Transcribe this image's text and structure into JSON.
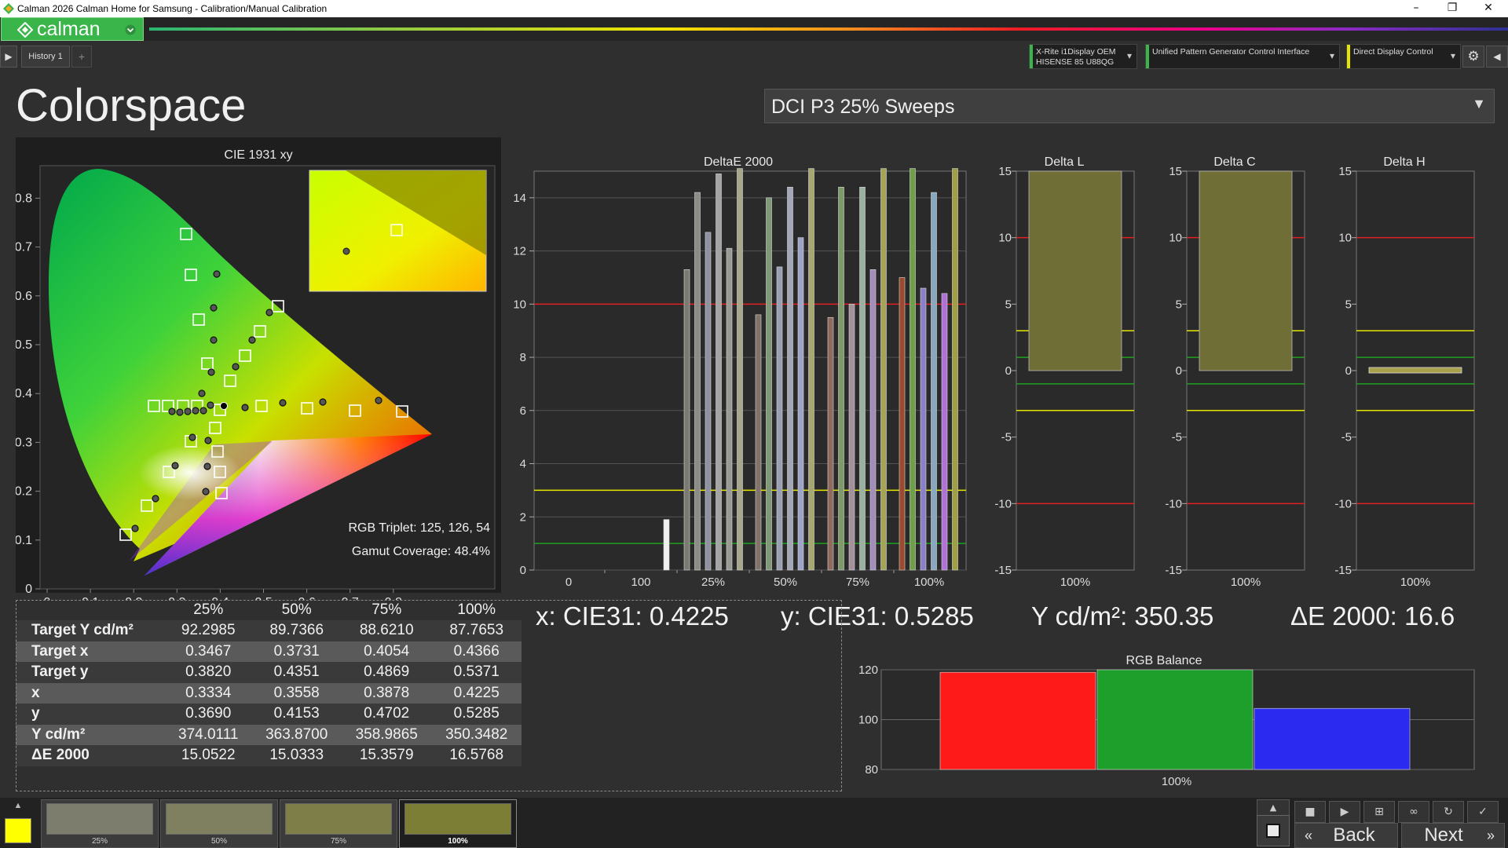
{
  "window": {
    "title": "Calman 2026 Calman Home for Samsung  - Calibration/Manual Calibration",
    "minimize": "–",
    "maximize": "❐",
    "close": "✕"
  },
  "brand": {
    "name": "calman",
    "accent": "#39b54a"
  },
  "toolbar": {
    "history_tab": "History 1",
    "add_tab": "+",
    "devices": [
      {
        "line1": "X-Rite i1Display OEM",
        "line2": "HISENSE 85 U88QG",
        "color": "#39b54a"
      },
      {
        "line1": "Unified Pattern Generator Control Interface",
        "line2": "",
        "color": "#39b54a"
      },
      {
        "line1": "Direct Display Control",
        "line2": "",
        "color": "#e6e600"
      }
    ]
  },
  "page": {
    "title": "Colorspace",
    "workflow_select": "DCI P3 25% Sweeps"
  },
  "cie": {
    "title": "CIE 1931 xy",
    "rgb_triplet": "RGB Triplet: 125, 126, 54",
    "gamut_coverage": "Gamut Coverage: 48.4%",
    "x_ticks": [
      "0",
      "0.1",
      "0.2",
      "0.3",
      "0.4",
      "0.5",
      "0.6",
      "0.7",
      "0.8"
    ],
    "y_ticks": [
      "0",
      "0.1",
      "0.2",
      "0.3",
      "0.4",
      "0.5",
      "0.6",
      "0.7",
      "0.8"
    ]
  },
  "readouts": {
    "x": "x: CIE31: 0.4225",
    "y": "y: CIE31: 0.5285",
    "Y": "Y cd/m²: 350.35",
    "de": "ΔE 2000: 16.6"
  },
  "table": {
    "headers": [
      "",
      "25%",
      "50%",
      "75%",
      "100%"
    ],
    "rows": [
      [
        "Target Y cd/m²",
        "92.2985",
        "89.7366",
        "88.6210",
        "87.7653"
      ],
      [
        "Target x",
        "0.3467",
        "0.3731",
        "0.4054",
        "0.4366"
      ],
      [
        "Target y",
        "0.3820",
        "0.4351",
        "0.4869",
        "0.5371"
      ],
      [
        "x",
        "0.3334",
        "0.3558",
        "0.3878",
        "0.4225"
      ],
      [
        "y",
        "0.3690",
        "0.4153",
        "0.4702",
        "0.5285"
      ],
      [
        "Y cd/m²",
        "374.0111",
        "363.8700",
        "358.9865",
        "350.3482"
      ],
      [
        "ΔE 2000",
        "15.0522",
        "15.0333",
        "15.3579",
        "16.5768"
      ]
    ]
  },
  "patches": [
    {
      "label": "25%",
      "color": "#7d7d6e"
    },
    {
      "label": "50%",
      "color": "#7f8060"
    },
    {
      "label": "75%",
      "color": "#7e7f48"
    },
    {
      "label": "100%",
      "color": "#7d7e36"
    }
  ],
  "nav": {
    "back": "Back",
    "next": "Next"
  },
  "chart_data": [
    {
      "type": "bar",
      "title": "DeltaE 2000",
      "ylim": [
        0,
        15
      ],
      "y_ticks": [
        "0",
        "2",
        "4",
        "6",
        "8",
        "10",
        "12",
        "14"
      ],
      "x_ticks": [
        "0",
        "100",
        "25%",
        "50%",
        "75%",
        "100%"
      ],
      "reference_lines": [
        {
          "value": 10,
          "color": "#e02020"
        },
        {
          "value": 3,
          "color": "#e6e600"
        },
        {
          "value": 1,
          "color": "#20a020"
        }
      ],
      "groups": [
        {
          "label": "100",
          "values": [
            1.9
          ],
          "colors": [
            "#f0f0f0"
          ]
        },
        {
          "label": "25%",
          "values": [
            11.3,
            14.2,
            12.7,
            14.9,
            12.1,
            15.1
          ],
          "colors": [
            "#7a7a72",
            "#8c8c86",
            "#8e92a0",
            "#a4a4a4",
            "#9a9a94",
            "#a7a78c"
          ]
        },
        {
          "label": "50%",
          "values": [
            9.6,
            14.0,
            11.4,
            14.4,
            12.5,
            15.1
          ],
          "colors": [
            "#80746a",
            "#7e9878",
            "#9aa0b4",
            "#a4a8b6",
            "#9ea4c8",
            "#a6a870"
          ]
        },
        {
          "label": "75%",
          "values": [
            9.5,
            14.4,
            10.0,
            14.4,
            11.3,
            15.1
          ],
          "colors": [
            "#906a5e",
            "#7e9a68",
            "#a4909a",
            "#9ab0a0",
            "#a28cbc",
            "#a4a458"
          ]
        },
        {
          "label": "100%",
          "values": [
            11.0,
            15.1,
            10.6,
            14.2,
            10.4,
            15.1
          ],
          "colors": [
            "#9a4a2e",
            "#6ea04a",
            "#8a80c8",
            "#88a8c0",
            "#b070d8",
            "#a0a042"
          ]
        }
      ]
    },
    {
      "type": "bar",
      "title": "Delta L",
      "ylim": [
        -15,
        15
      ],
      "categories": [
        "100%"
      ],
      "values": [
        15.0
      ],
      "reference_lines": [
        10,
        3,
        1,
        -1,
        -3,
        -10
      ],
      "y_ticks": [
        "15",
        "10",
        "5",
        "0",
        "-5",
        "-10",
        "-15"
      ]
    },
    {
      "type": "bar",
      "title": "Delta C",
      "ylim": [
        -15,
        15
      ],
      "categories": [
        "100%"
      ],
      "values": [
        15.0
      ],
      "reference_lines": [
        10,
        3,
        1,
        -1,
        -3,
        -10
      ],
      "y_ticks": [
        "15",
        "10",
        "5",
        "0",
        "-5",
        "-10",
        "-15"
      ]
    },
    {
      "type": "bar",
      "title": "Delta H",
      "ylim": [
        -15,
        15
      ],
      "categories": [
        "100%"
      ],
      "values": [
        -0.2
      ],
      "reference_lines": [
        10,
        3,
        1,
        -1,
        -3,
        -10
      ],
      "y_ticks": [
        "15",
        "10",
        "5",
        "0",
        "-5",
        "-10",
        "-15"
      ]
    },
    {
      "type": "bar",
      "title": "RGB Balance",
      "ylim": [
        80,
        120
      ],
      "y_ticks": [
        "120",
        "100",
        "80"
      ],
      "categories": [
        "100%"
      ],
      "series": [
        {
          "name": "R",
          "values": [
            119
          ],
          "color": "#ff1a1a"
        },
        {
          "name": "G",
          "values": [
            120
          ],
          "color": "#1e9e2a"
        },
        {
          "name": "B",
          "values": [
            104.5
          ],
          "color": "#2a2af0"
        }
      ]
    }
  ]
}
